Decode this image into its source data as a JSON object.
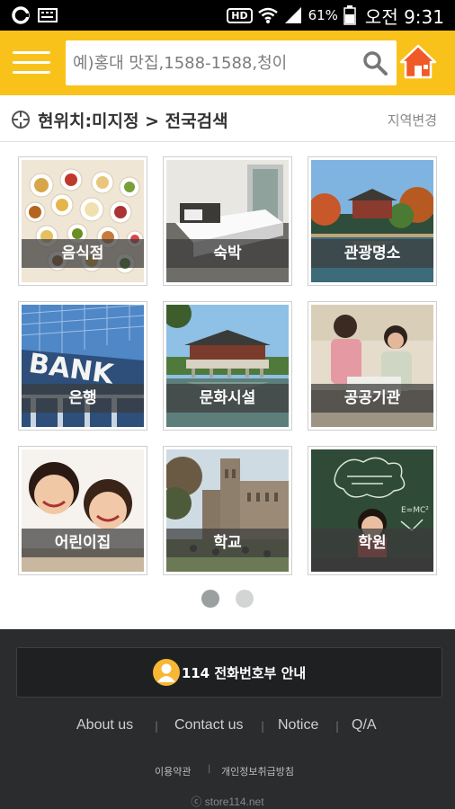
{
  "status_bar": {
    "battery_percent": "61%",
    "time": "오전 9:31",
    "hd_label": "HD"
  },
  "header": {
    "search_placeholder": "예)홍대 맛집,1588-1588,청이"
  },
  "location": {
    "current": "현위치:미지정 > 전국검색",
    "change_label": "지역변경"
  },
  "categories": [
    {
      "label": "음식점"
    },
    {
      "label": "숙박"
    },
    {
      "label": "관광명소"
    },
    {
      "label": "은행"
    },
    {
      "label": "문화시설"
    },
    {
      "label": "공공기관"
    },
    {
      "label": "어린이집"
    },
    {
      "label": "학교"
    },
    {
      "label": "학원"
    }
  ],
  "pager": {
    "current_page": 1,
    "total_pages": 2
  },
  "footer": {
    "phonebook_label": "114 전화번호부 안내",
    "links": [
      "About us",
      "Contact us",
      "Notice",
      "Q/A"
    ],
    "terms": "이용약관",
    "privacy": "개인정보취급방침",
    "copyright": "ⓒ store114.net"
  },
  "colors": {
    "brand_yellow": "#f9c21b",
    "footer_bg": "#2a2c2e",
    "home_icon": "#f05a28"
  }
}
